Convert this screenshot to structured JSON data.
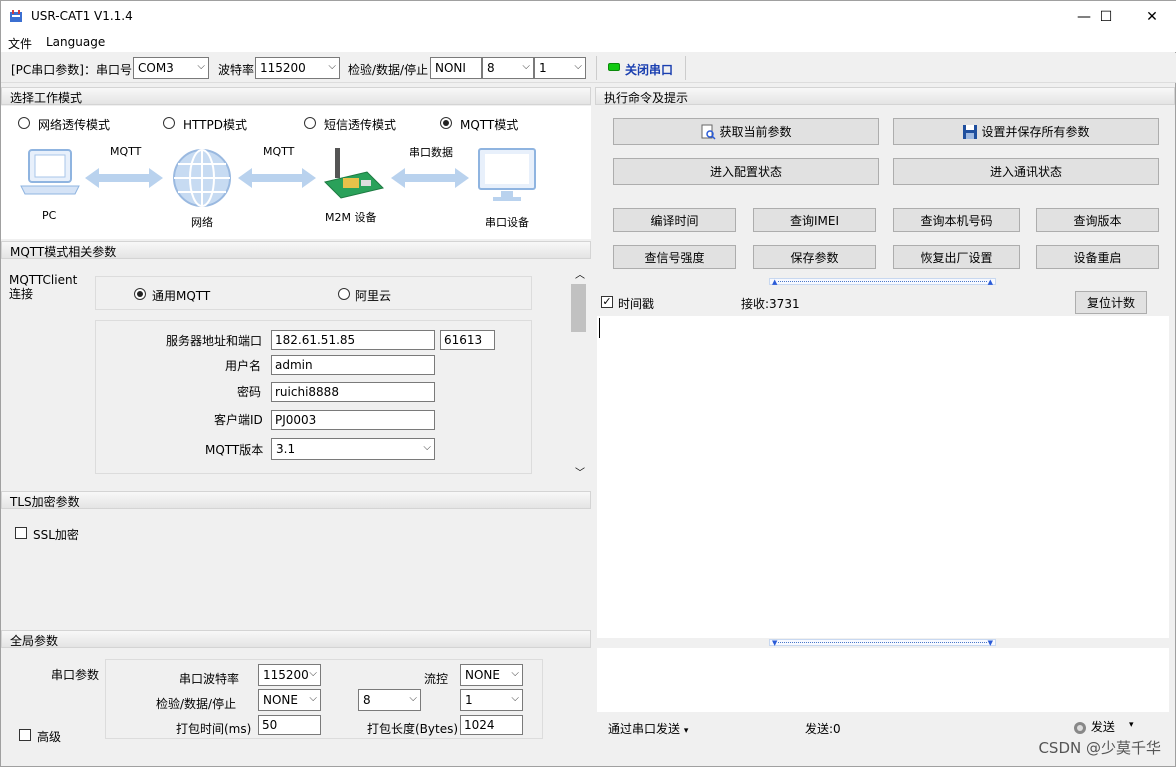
{
  "window": {
    "title": "USR-CAT1 V1.1.4",
    "minimize": "—",
    "maximize": "☐",
    "close": "✕"
  },
  "menu": {
    "file": "文件",
    "language": "Language"
  },
  "toolbar": {
    "pc_label": "[PC串口参数]：串口号",
    "port": "COM3",
    "baud_label": "波特率",
    "baud": "115200",
    "check_label": "检验/数据/停止",
    "parity": "NONI",
    "data_bits": "8",
    "stop_bits": "1",
    "close_port": "关闭串口"
  },
  "work_mode": {
    "header": "选择工作模式",
    "modes": [
      "网络透传模式",
      "HTTPD模式",
      "短信透传模式",
      "MQTT模式"
    ],
    "selected": "MQTT模式",
    "diagram": {
      "pc": "PC",
      "mqtt1": "MQTT",
      "network": "网络",
      "mqtt2": "MQTT",
      "m2m": "M2M 设备",
      "serial_data": "串口数据",
      "serial_device": "串口设备"
    }
  },
  "mqtt": {
    "header": "MQTT模式相关参数",
    "client_label": "MQTTClient\n连接",
    "opt_generic": "通用MQTT",
    "opt_aliyun": "阿里云",
    "server_label": "服务器地址和端口",
    "server": "182.61.51.85",
    "port": "61613",
    "user_label": "用户名",
    "user": "admin",
    "pass_label": "密码",
    "pass": "ruichi8888",
    "client_id_label": "客户端ID",
    "client_id": "PJ0003",
    "version_label": "MQTT版本",
    "version": "3.1"
  },
  "tls": {
    "header": "TLS加密参数",
    "ssl": "SSL加密"
  },
  "global": {
    "header": "全局参数",
    "serial_params": "串口参数",
    "baud_label": "串口波特率",
    "baud": "115200",
    "flow_label": "流控",
    "flow": "NONE",
    "check_label": "检验/数据/停止",
    "parity": "NONE",
    "data_bits": "8",
    "stop_bits": "1",
    "pack_time_label": "打包时间(ms)",
    "pack_time": "50",
    "pack_len_label": "打包长度(Bytes)",
    "pack_len": "1024",
    "advanced": "高级"
  },
  "commands": {
    "header": "执行命令及提示",
    "get_params": "获取当前参数",
    "save_all": "设置并保存所有参数",
    "enter_config": "进入配置状态",
    "enter_comm": "进入通讯状态",
    "compile_time": "编译时间",
    "query_imei": "查询IMEI",
    "query_number": "查询本机号码",
    "query_version": "查询版本",
    "signal": "查信号强度",
    "save_params": "保存参数",
    "factory_reset": "恢复出厂设置",
    "reboot": "设备重启"
  },
  "log": {
    "timestamp": "时间戳",
    "recv": "接收:3731",
    "reset_count": "复位计数"
  },
  "send": {
    "via": "通过串口发送",
    "sent": "发送:0",
    "send_btn": "发送"
  },
  "watermark": "CSDN @少莫千华"
}
